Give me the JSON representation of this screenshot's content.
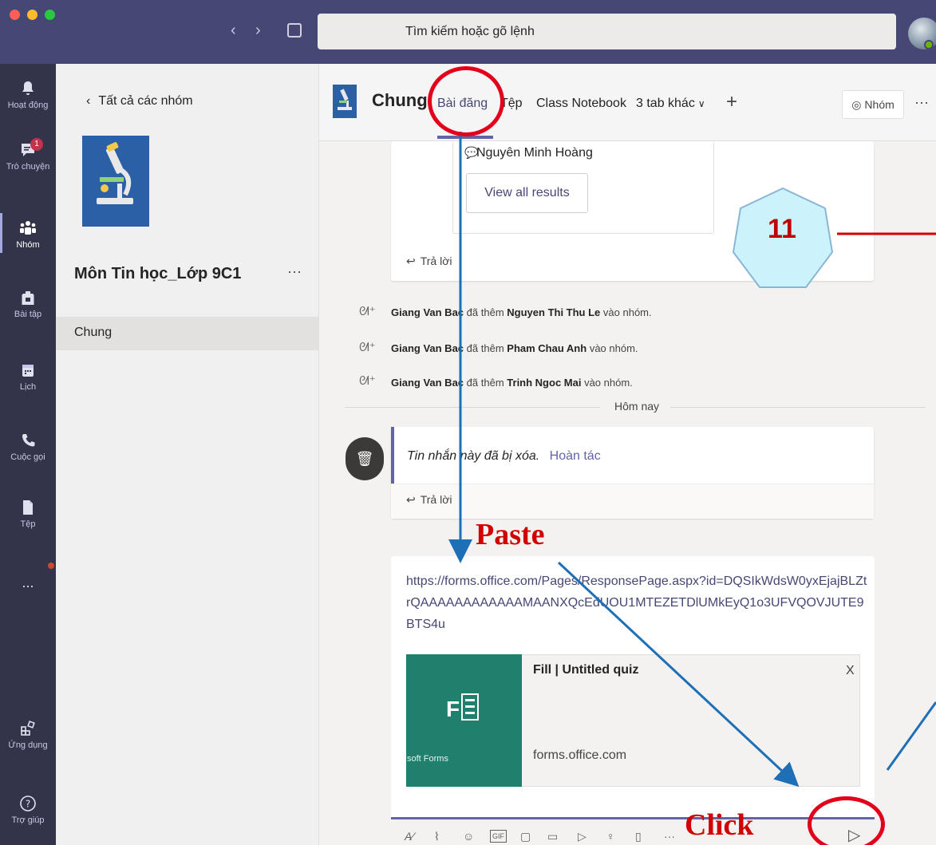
{
  "search": {
    "placeholder": "Tìm kiếm hoặc gõ lệnh"
  },
  "rail": {
    "items": [
      {
        "label": "Hoạt động",
        "icon": "bell-icon"
      },
      {
        "label": "Trò chuyện",
        "icon": "chat-icon",
        "badge": "1"
      },
      {
        "label": "Nhóm",
        "icon": "teams-icon"
      },
      {
        "label": "Bài tập",
        "icon": "backpack-icon"
      },
      {
        "label": "Lịch",
        "icon": "calendar-icon"
      },
      {
        "label": "Cuộc gọi",
        "icon": "phone-icon"
      },
      {
        "label": "Tệp",
        "icon": "file-icon"
      },
      {
        "label": "...",
        "icon": "more-icon"
      },
      {
        "label": "Ứng dụng",
        "icon": "apps-icon"
      },
      {
        "label": "Trợ giúp",
        "icon": "help-icon"
      }
    ]
  },
  "teampanel": {
    "back": "Tất cả các nhóm",
    "team_name": "Môn Tin học_Lớp 9C1",
    "more": "···",
    "channel": "Chung"
  },
  "header": {
    "channel": "Chung",
    "tabs": [
      "Bài đăng",
      "Tệp",
      "Class Notebook",
      "3 tab khác"
    ],
    "team_button": "Nhóm",
    "more": "···"
  },
  "thread1": {
    "author": "Nguyên Minh Hoàng",
    "button": "View all results",
    "reply": "Trả lời"
  },
  "system_messages": [
    {
      "actor": "Giang Van Bac",
      "verb": "đã thêm",
      "target": "Nguyen Thi Thu Le",
      "tail": "vào nhóm."
    },
    {
      "actor": "Giang Van Bac",
      "verb": "đã thêm",
      "target": "Pham Chau Anh",
      "tail": "vào nhóm."
    },
    {
      "actor": "Giang Van Bac",
      "verb": "đã thêm",
      "target": "Trinh Ngoc Mai",
      "tail": "vào nhóm."
    }
  ],
  "divider": "Hôm nay",
  "deleted": {
    "text": "Tin nhắn này đã bị xóa.",
    "undo": "Hoàn tác",
    "reply": "Trả lời"
  },
  "composer": {
    "url": "https://forms.office.com/Pages/ResponsePage.aspx?id=DQSIkWdsW0yxEjajBLZtrQAAAAAAAAAAAAMAANXQcEdUOU1MTEZETDlUMkEyQ1o3UFVQOVJUTE9BTS4u",
    "preview_title": "Fill | Untitled quiz",
    "preview_domain": "forms.office.com",
    "preview_brand": "soft Forms",
    "preview_close": "X"
  },
  "annotations": {
    "step_number": "11",
    "paste_label": "Paste",
    "click_label": "Click"
  },
  "colors": {
    "titlebar": "#464775",
    "rail": "#33344a",
    "accent": "#6264a7",
    "annotation_red": "#e3001b",
    "arrow_blue": "#1f6fb7",
    "forms_green": "#217f6e"
  }
}
